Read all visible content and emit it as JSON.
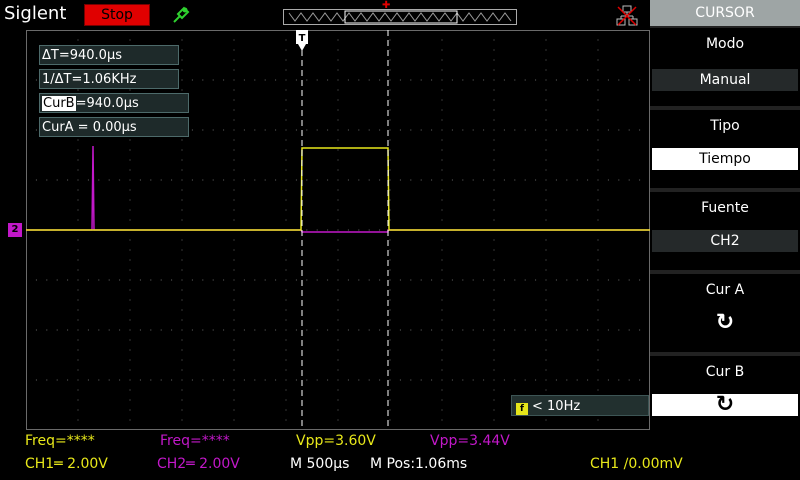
{
  "brand": "Siglent",
  "status": {
    "label": "Stop",
    "color": "#e00000"
  },
  "readouts": {
    "delta_t": "ΔT=940.0µs",
    "inv_delta_t": "1/ΔT=1.06KHz",
    "curb_label": "CurB",
    "curb_value": "=940.0µs",
    "cura": "CurA = 0.00µs"
  },
  "trigger_source_readout": {
    "icon_letter": "f",
    "text": "< 10Hz"
  },
  "channel_marker": "2",
  "bottom": {
    "freq1": "Freq=****",
    "freq2": "Freq=****",
    "vpp1": "Vpp=3.60V",
    "vpp2": "Vpp=3.44V",
    "ch1": "CH1═ 2.00V",
    "ch2": "CH2═ 2.00V",
    "timebase": "M 500µs",
    "mpos": "M Pos:1.06ms",
    "trigger": "CH1 ∕0.00mV"
  },
  "menu": {
    "title": "CURSOR",
    "items": [
      {
        "label": "Modo",
        "value": "Manual"
      },
      {
        "label": "Tipo",
        "value": "Tiempo"
      },
      {
        "label": "Fuente",
        "value": "CH2"
      },
      {
        "label": "Cur A",
        "value": "↻"
      },
      {
        "label": "Cur B",
        "value": "↻"
      }
    ]
  },
  "colors": {
    "ch1": "#e8e81a",
    "ch2": "#c218c9",
    "grid": "#6a6a6a",
    "panel": "#1e2a2a"
  }
}
